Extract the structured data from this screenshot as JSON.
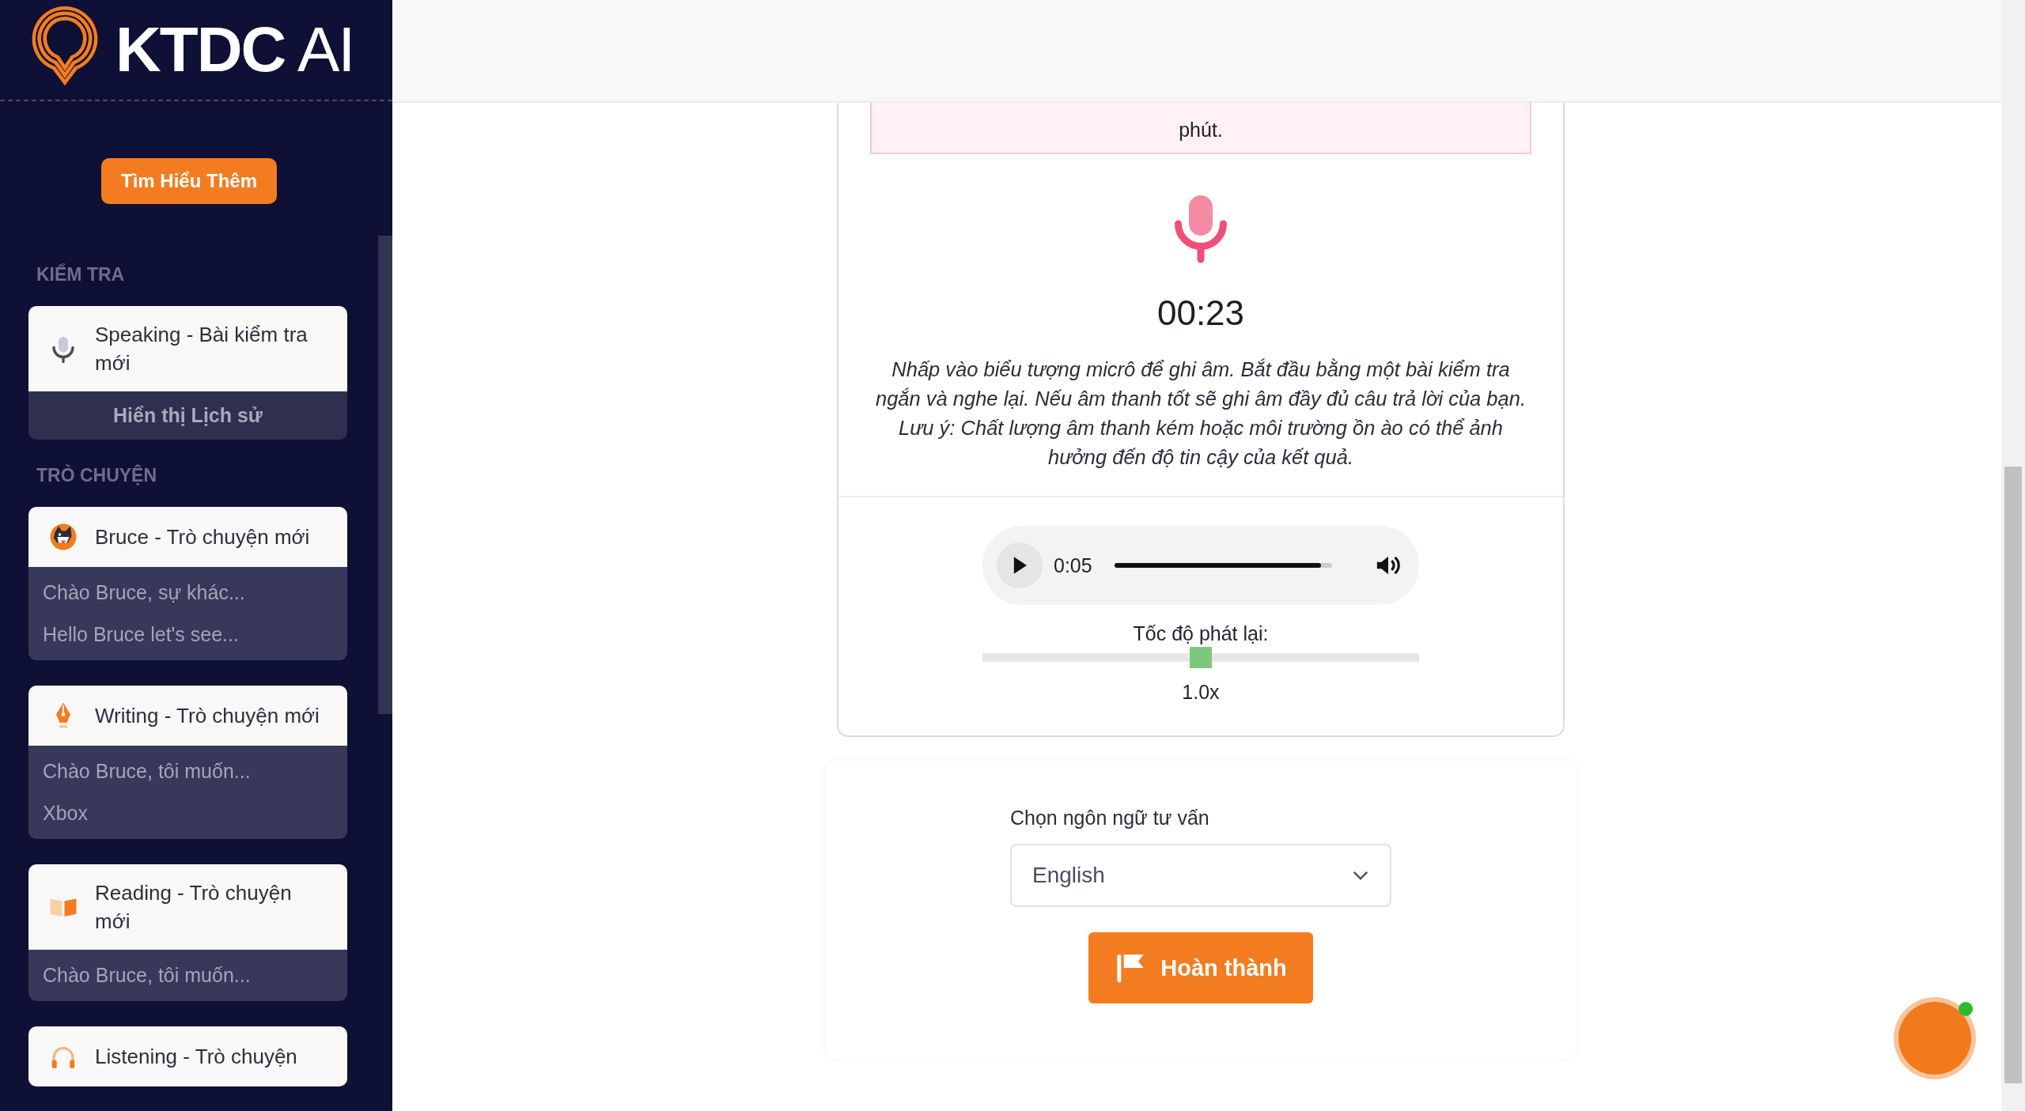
{
  "sidebar": {
    "logo": {
      "brand": "KTDC",
      "suffix": "AI"
    },
    "cta_button": "Tìm Hiểu Thêm",
    "sections": [
      {
        "title": "KIỂM TRA",
        "items": [
          {
            "kind": "mic",
            "title": "Speaking - Bài kiểm tra mới",
            "footer_button": "Hiển thị Lịch sử"
          }
        ]
      },
      {
        "title": "TRÒ CHUYỆN",
        "items": [
          {
            "kind": "dog",
            "title": "Bruce - Trò chuyện mới",
            "history": [
              "Chào Bruce, sự khác...",
              "Hello Bruce let's see..."
            ]
          },
          {
            "kind": "pen",
            "title": "Writing - Trò chuyện mới",
            "history": [
              "Chào Bruce, tôi muốn...",
              "Xbox"
            ]
          },
          {
            "kind": "book",
            "title": "Reading - Trò chuyện mới",
            "history": [
              "Chào Bruce, tôi muốn..."
            ]
          },
          {
            "kind": "headphones",
            "title": "Listening - Trò chuyện"
          }
        ]
      }
    ]
  },
  "recorder": {
    "notice": "phút.",
    "timer": "00:23",
    "instructions": "Nhấp vào biểu tượng micrô để ghi âm. Bắt đầu bằng một bài kiểm tra ngắn và nghe lại. Nếu âm thanh tốt sẽ ghi âm đầy đủ câu trả lời của bạn. Lưu ý: Chất lượng âm thanh kém hoặc môi trường ồn ào có thể ảnh hưởng đến độ tin cậy của kết quả.",
    "player": {
      "time": "0:05",
      "level": 0.95
    },
    "speed": {
      "label": "Tốc độ phát lại:",
      "level": 0.5,
      "value": "1.0x"
    }
  },
  "consult": {
    "label": "Chọn ngôn ngữ tư vấn",
    "language": "English",
    "submit_button": "Hoàn thành"
  },
  "chat_avatar": {
    "online": true
  }
}
